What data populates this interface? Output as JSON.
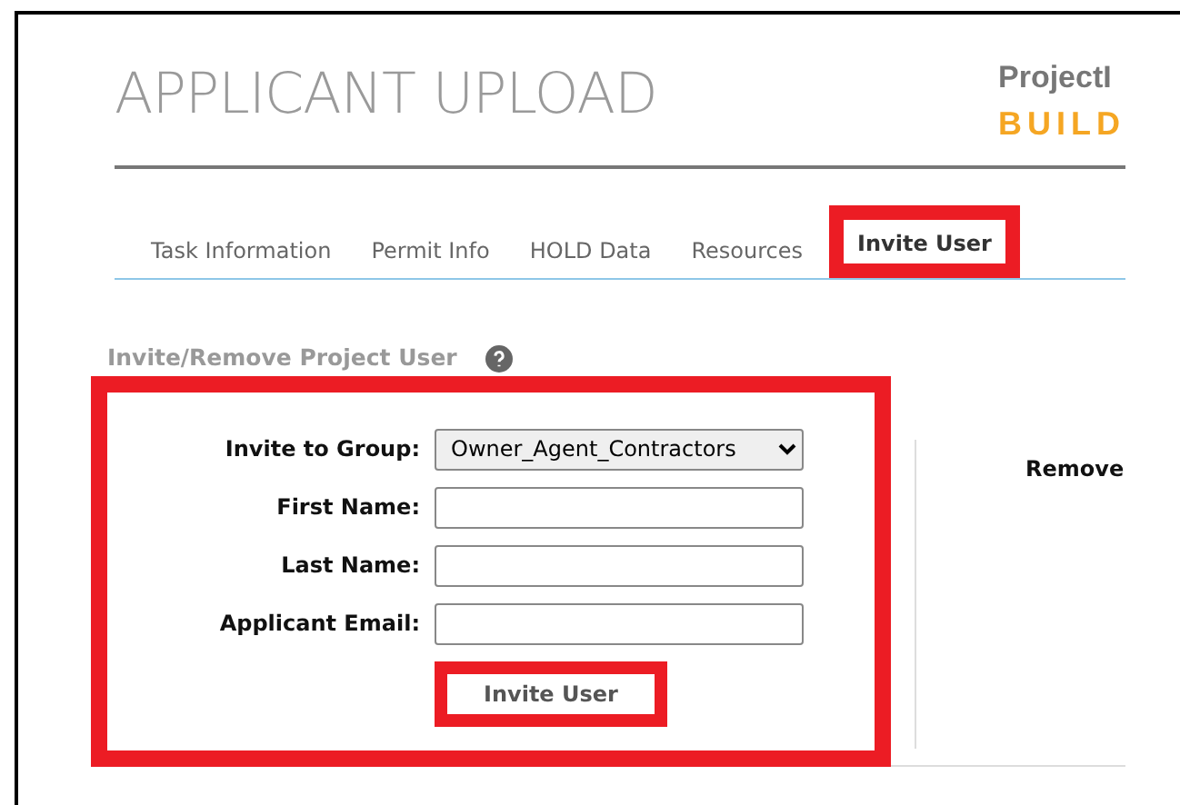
{
  "page": {
    "title": "APPLICANT UPLOAD"
  },
  "logo": {
    "line_1": "ProjectI",
    "line_2": "BUILD"
  },
  "tabs": [
    {
      "label": "Task Information",
      "selected": false,
      "highlighted": false
    },
    {
      "label": "Permit Info",
      "selected": false,
      "highlighted": false
    },
    {
      "label": "HOLD Data",
      "selected": false,
      "highlighted": false
    },
    {
      "label": "Resources",
      "selected": false,
      "highlighted": false
    },
    {
      "label": "Invite User",
      "selected": true,
      "highlighted": true
    }
  ],
  "invite_section": {
    "heading": "Invite/Remove Project User",
    "highlighted": true,
    "fields": [
      {
        "kind": "select",
        "label": "Invite to Group:",
        "value": "Owner_Agent_Contractors"
      },
      {
        "kind": "text",
        "label": "First Name:"
      },
      {
        "kind": "text",
        "label": "Last Name:"
      },
      {
        "kind": "text",
        "label": "Applicant Email:"
      }
    ],
    "button": {
      "label": "Invite User",
      "highlighted": true
    }
  },
  "remove_section": {
    "heading": "Remove"
  }
}
